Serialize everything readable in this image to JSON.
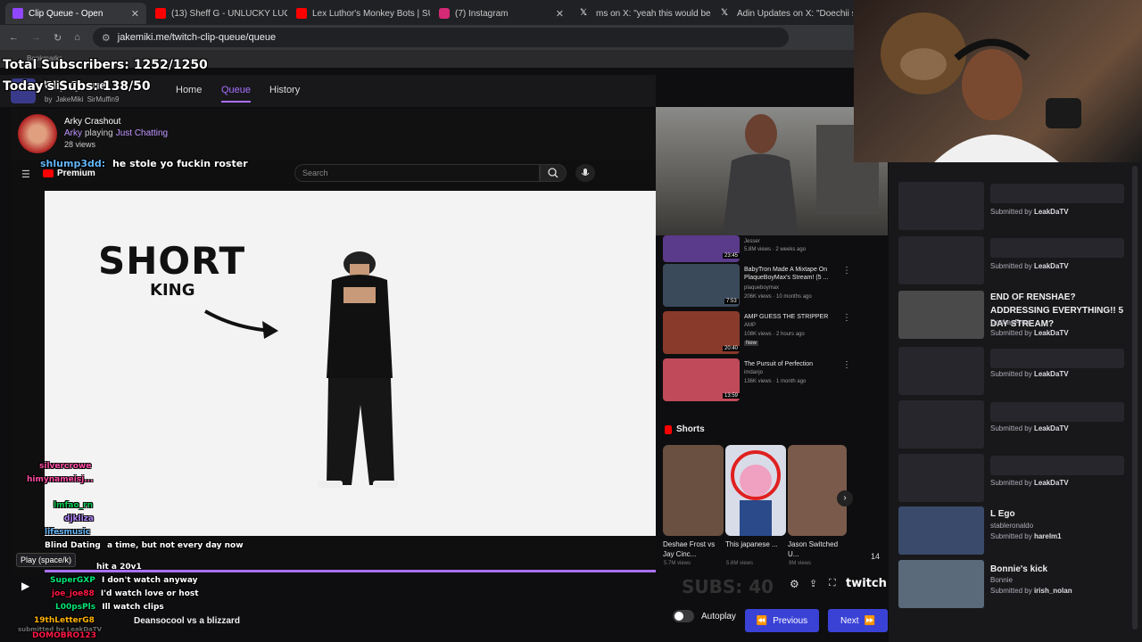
{
  "tabs": [
    {
      "title": "Clip Queue - Open",
      "color": "#9147ff"
    },
    {
      "title": "(13) Sheff G - UNLUCKY LUCKY",
      "color": "#ff0000"
    },
    {
      "title": "Lex Luthor's Monkey Bots | SUP",
      "color": "#ff0000"
    },
    {
      "title": "(7) Instagram",
      "color": "#d62976"
    },
    {
      "title": "ms on X: \"yeah this would be m",
      "color": "#000000"
    },
    {
      "title": "Adin Updates on X: \"Doechii se",
      "color": "#000000"
    }
  ],
  "address": "jakemiki.me/twitch-clip-queue/queue",
  "bookmarks_label": "Bookmarks",
  "overlay": {
    "total_subs": "Total Subscribers: 1252/1250",
    "today_subs": "Today's Subs: 138/50",
    "subs_counter": "SUBS: 40"
  },
  "site": {
    "title": "Clip Queue",
    "by": "by",
    "author1": "JakeMiki",
    "author2": "SirMuffin9",
    "nav": [
      "Home",
      "Queue",
      "History"
    ]
  },
  "clip_header": {
    "title": "Arky Crashout",
    "channel": "Arky",
    "playing": "playing",
    "category": "Just Chatting",
    "views": "28 views"
  },
  "youtube": {
    "premium_label": "Premium",
    "search_placeholder": "Search",
    "video_text_1": "SHORT",
    "video_text_2": "KING",
    "shorts_heading": "Shorts",
    "time_badge": "14"
  },
  "recommendations": [
    {
      "title": "",
      "channel": "Jesser",
      "meta": "5.8M views · 2 weeks ago",
      "duration": "23:45",
      "color": "#5a3a8a"
    },
    {
      "title": "BabyTron Made A Mixtape On PlaqueBoyMax's Stream! (5 ...",
      "channel": "plaqueboymax",
      "meta": "206K views · 10 months ago",
      "duration": "7:53",
      "color": "#3a4a5a"
    },
    {
      "title": "AMP GUESS THE STRIPPER",
      "channel": "AMP",
      "meta": "108K views · 2 hours ago",
      "badge": "New",
      "duration": "20:40",
      "color": "#8a3a2a"
    },
    {
      "title": "The Pursuit of Perfection",
      "channel": "imdanjo",
      "meta": "136K views · 1 month ago",
      "duration": "13:59",
      "color": "#c04a5a"
    }
  ],
  "shorts": [
    {
      "title": "Deshae Frost vs Jay Cinc...",
      "meta": "5.7M views",
      "color": "#6a5040"
    },
    {
      "title": "This japanese ...",
      "meta": "5.6M views",
      "color": "#d8dce8"
    },
    {
      "title": "Jason Switched U...",
      "meta": "9M views",
      "color": "#7a5a4a"
    }
  ],
  "queue": [
    {
      "title": "",
      "submitter": "LeakDaTV"
    },
    {
      "title": "",
      "submitter": "LeakDaTV"
    },
    {
      "title": "END OF RENSHAE? ADDRESSING EVERYTHING!! 5 DAY STREAM?",
      "creator": "DeshaeFrost",
      "submitter": "LeakDaTV"
    },
    {
      "title": "",
      "submitter": "LeakDaTV"
    },
    {
      "title": "",
      "submitter": "LeakDaTV"
    },
    {
      "title": "",
      "submitter": "LeakDaTV"
    },
    {
      "title": "L Ego",
      "creator": "stableronaldo",
      "submitter": "harelm1"
    },
    {
      "title": "Bonnie's kick",
      "creator": "Bonnie",
      "submitter": "irish_nolan"
    }
  ],
  "submitted_by": "Submitted by",
  "chat": [
    {
      "user": "silvercrowe",
      "msg": "",
      "color": "#ff4da6"
    },
    {
      "user": "himynameisj...",
      "msg": "",
      "color": "#ff4da6"
    },
    {
      "user": "lmfao_rn",
      "msg": "",
      "color": "#00c853"
    },
    {
      "user": "djkliza",
      "msg": "",
      "color": "#b388ff"
    },
    {
      "user": "lifesmusic",
      "msg": "",
      "color": "#64b5f6"
    },
    {
      "user": "SuperGXP",
      "msg": "I don't watch anyway",
      "color": "#00e676"
    },
    {
      "user": "joe_joe88",
      "msg": "I'd watch love or host",
      "color": "#ff1744"
    },
    {
      "user": "L00psPls",
      "msg": "Ill watch clips",
      "color": "#00e676"
    },
    {
      "user": "19thLetterG8",
      "msg": "",
      "color": "#ffb300"
    },
    {
      "user": "DOMOBRO123",
      "msg": "",
      "color": "#ff1744"
    },
    {
      "user": "shlump3dd:",
      "msg": "he stole yo fuckin roster",
      "color": "#64b5f6"
    }
  ],
  "misc_overlay": {
    "blind_dating": "Blind Dating",
    "a_time": "a time, but not every day now",
    "hit_a": "hit a 20v1",
    "play_tooltip": "Play (space/k)",
    "submitted_bottom": "submitted by LeakDaTV"
  },
  "bottom": {
    "current_title": "Deansocool vs a blizzard",
    "autoplay_label": "Autoplay",
    "prev_label": "Previous",
    "next_label": "Next"
  },
  "twitch_logo": "twitch"
}
